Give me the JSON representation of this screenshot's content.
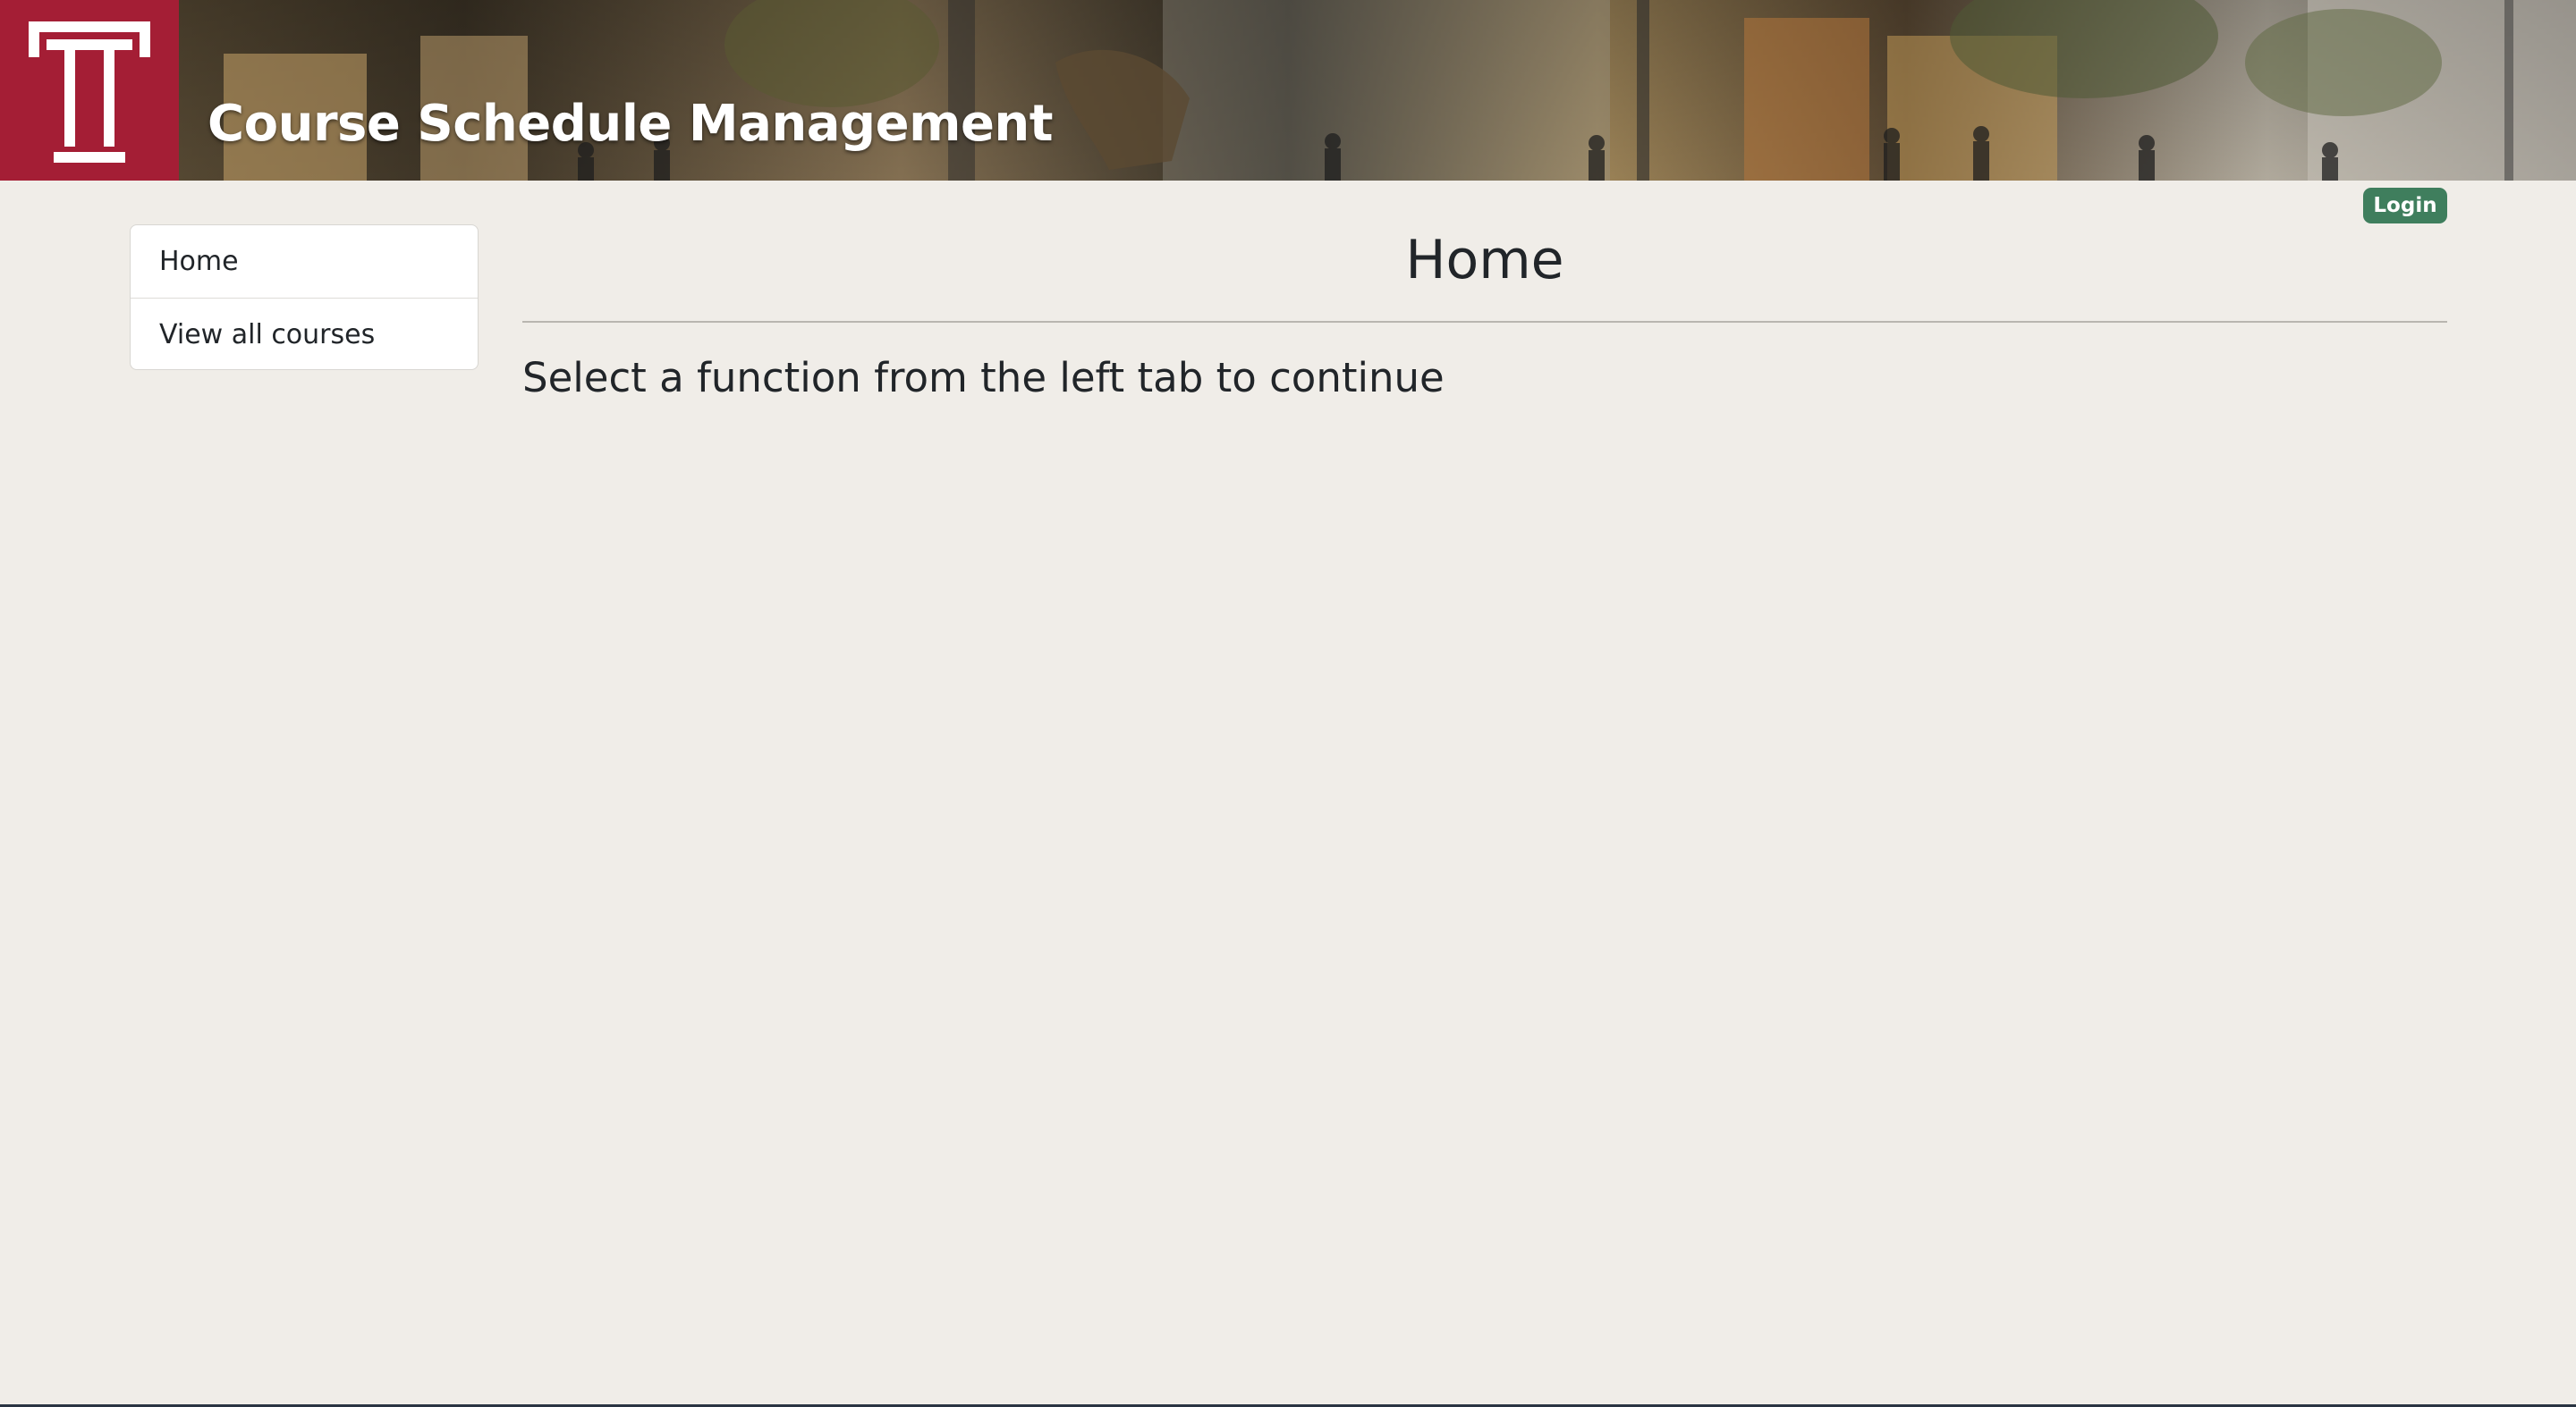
{
  "header": {
    "logo_letter": "T",
    "title": "Course Schedule Management"
  },
  "auth": {
    "login_label": "Login",
    "login_color": "#3f7e5d"
  },
  "sidebar": {
    "items": [
      {
        "label": "Home"
      },
      {
        "label": "View all courses"
      }
    ]
  },
  "main": {
    "title": "Home",
    "message": "Select a function from the left tab to continue"
  },
  "colors": {
    "brand": "#a41e35",
    "background": "#f0ede8"
  }
}
